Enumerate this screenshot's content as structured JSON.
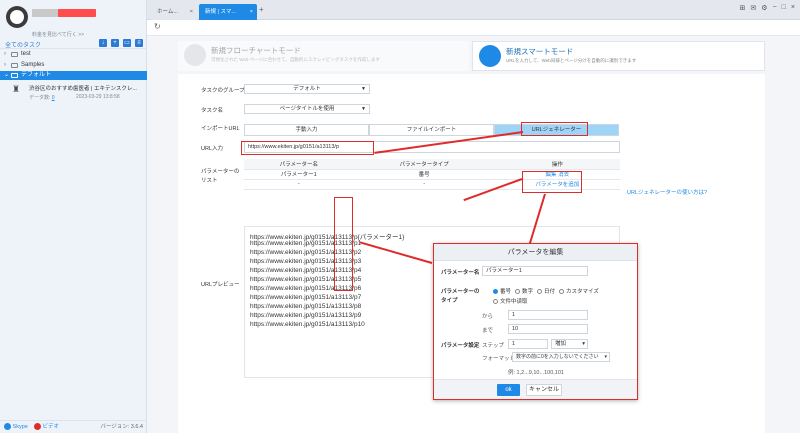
{
  "sidebar": {
    "upgrade_text": "料金を見比べて行く >>",
    "header_title": "全てのタスク",
    "tree": [
      {
        "label": "test",
        "chevron": "›"
      },
      {
        "label": "Samples",
        "chevron": "›"
      },
      {
        "label": "デフォルト",
        "chevron": "⌄"
      }
    ],
    "task": {
      "title": "渋谷区のおすすめ歯医者 | エキテンスクレ...",
      "data_label": "データ数:",
      "data_count": "0",
      "date": "2023-03-29 13:8:58"
    },
    "footer": {
      "skype": "Skype",
      "video": "ビデオ",
      "version": "バージョン: 3.6.4"
    }
  },
  "tabs": [
    {
      "label": "ホーム..."
    },
    {
      "label": "新規 | スマ..."
    }
  ],
  "modes": {
    "flowchart": {
      "title": "新規フローチャートモード",
      "desc": "可視化された Web ページに合わせて、自動的にスクレイピングタスクを作成します"
    },
    "smart": {
      "title": "新規スマートモード",
      "desc": "URLを入力して、Web同様とページ分けを自動的に識別できます"
    }
  },
  "form": {
    "group_label": "タスクのグループ",
    "group_value": "デフォルト",
    "name_label": "タスク名",
    "name_value": "ページタイトルを使用",
    "import_label": "インポートURL",
    "import_tabs": [
      "手動入力",
      "ファイルインポート",
      "URLジェネレーター"
    ],
    "url_label": "URL入力",
    "url_value": "https://www.ekiten.jp/g0151/a13113/p",
    "param_label": "パラメーターのリスト",
    "table_headers": [
      "パラメーター名",
      "パラメータータイプ",
      "操作"
    ],
    "table_row": {
      "name": "パラメーター1",
      "type": "番号",
      "edit": "編集",
      "delete": "消去"
    },
    "table_row2": {
      "name": "-",
      "type": "-",
      "add": "パラメータを追加"
    },
    "help_link": "URLジェネレーターの使い方は?",
    "preview_label": "URLプレビュー",
    "preview_lines": [
      "https://www.ekiten.jp/g0151/a13113/p{パラメーター1}",
      "https://www.ekiten.jp/g0151/a13113/p1",
      "https://www.ekiten.jp/g0151/a13113/p2",
      "https://www.ekiten.jp/g0151/a13113/p3",
      "https://www.ekiten.jp/g0151/a13113/p4",
      "https://www.ekiten.jp/g0151/a13113/p5",
      "https://www.ekiten.jp/g0151/a13113/p6",
      "https://www.ekiten.jp/g0151/a13113/p7",
      "https://www.ekiten.jp/g0151/a13113/p8",
      "https://www.ekiten.jp/g0151/a13113/p9",
      "https://www.ekiten.jp/g0151/a13113/p10"
    ]
  },
  "dialog": {
    "title": "パラメータを編集",
    "name_label": "パラメーター名",
    "name_value": "パラメーター1",
    "type_label": "パラメーターのタイプ",
    "types": [
      "番号",
      "数字",
      "日付",
      "カスタマイズ",
      "文件中读取"
    ],
    "setting_label": "パラメータ設定",
    "from_label": "から",
    "from_value": "1",
    "to_label": "まで",
    "to_value": "10",
    "step_label": "ステップ",
    "step_value": "1",
    "step_mode": "増加",
    "format_label": "フォーマット",
    "format_value": "数字の前に0を入力しないでください",
    "example": "例: 1,2...9,10...100,101",
    "ok": "ok",
    "cancel": "キャンセル"
  },
  "colors": {
    "accent": "#1f8ae6",
    "annotation": "#e02b2b"
  }
}
